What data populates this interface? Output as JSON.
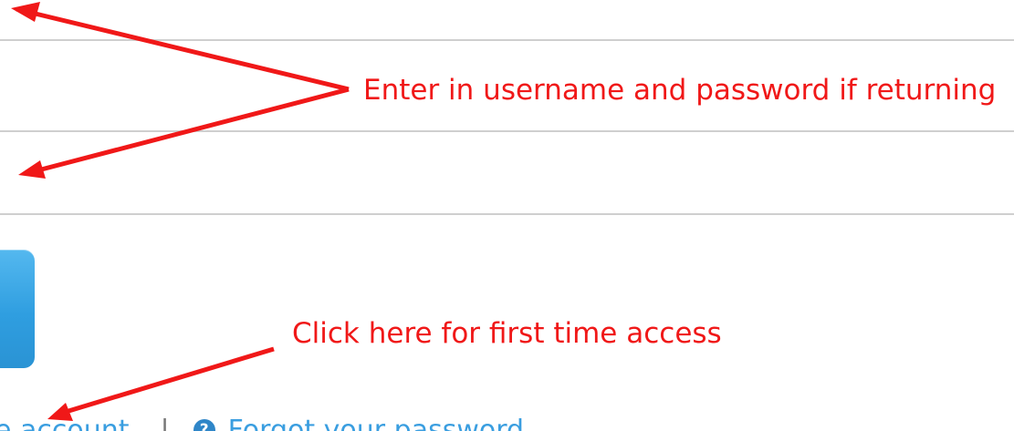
{
  "annotations": {
    "login_note": "Enter in username and password if returning",
    "first_time_note": "Click here for first time access"
  },
  "links": {
    "create_account": "e account",
    "separator": "|",
    "help_icon_glyph": "?",
    "forgot_password": "Forgot your password"
  },
  "colors": {
    "annotation": "#f01818",
    "link": "#3a9ee0",
    "button": "#2f9ee0",
    "divider": "#cfcfcf"
  },
  "icons": [
    "arrow-annotation",
    "help-circle-icon"
  ]
}
